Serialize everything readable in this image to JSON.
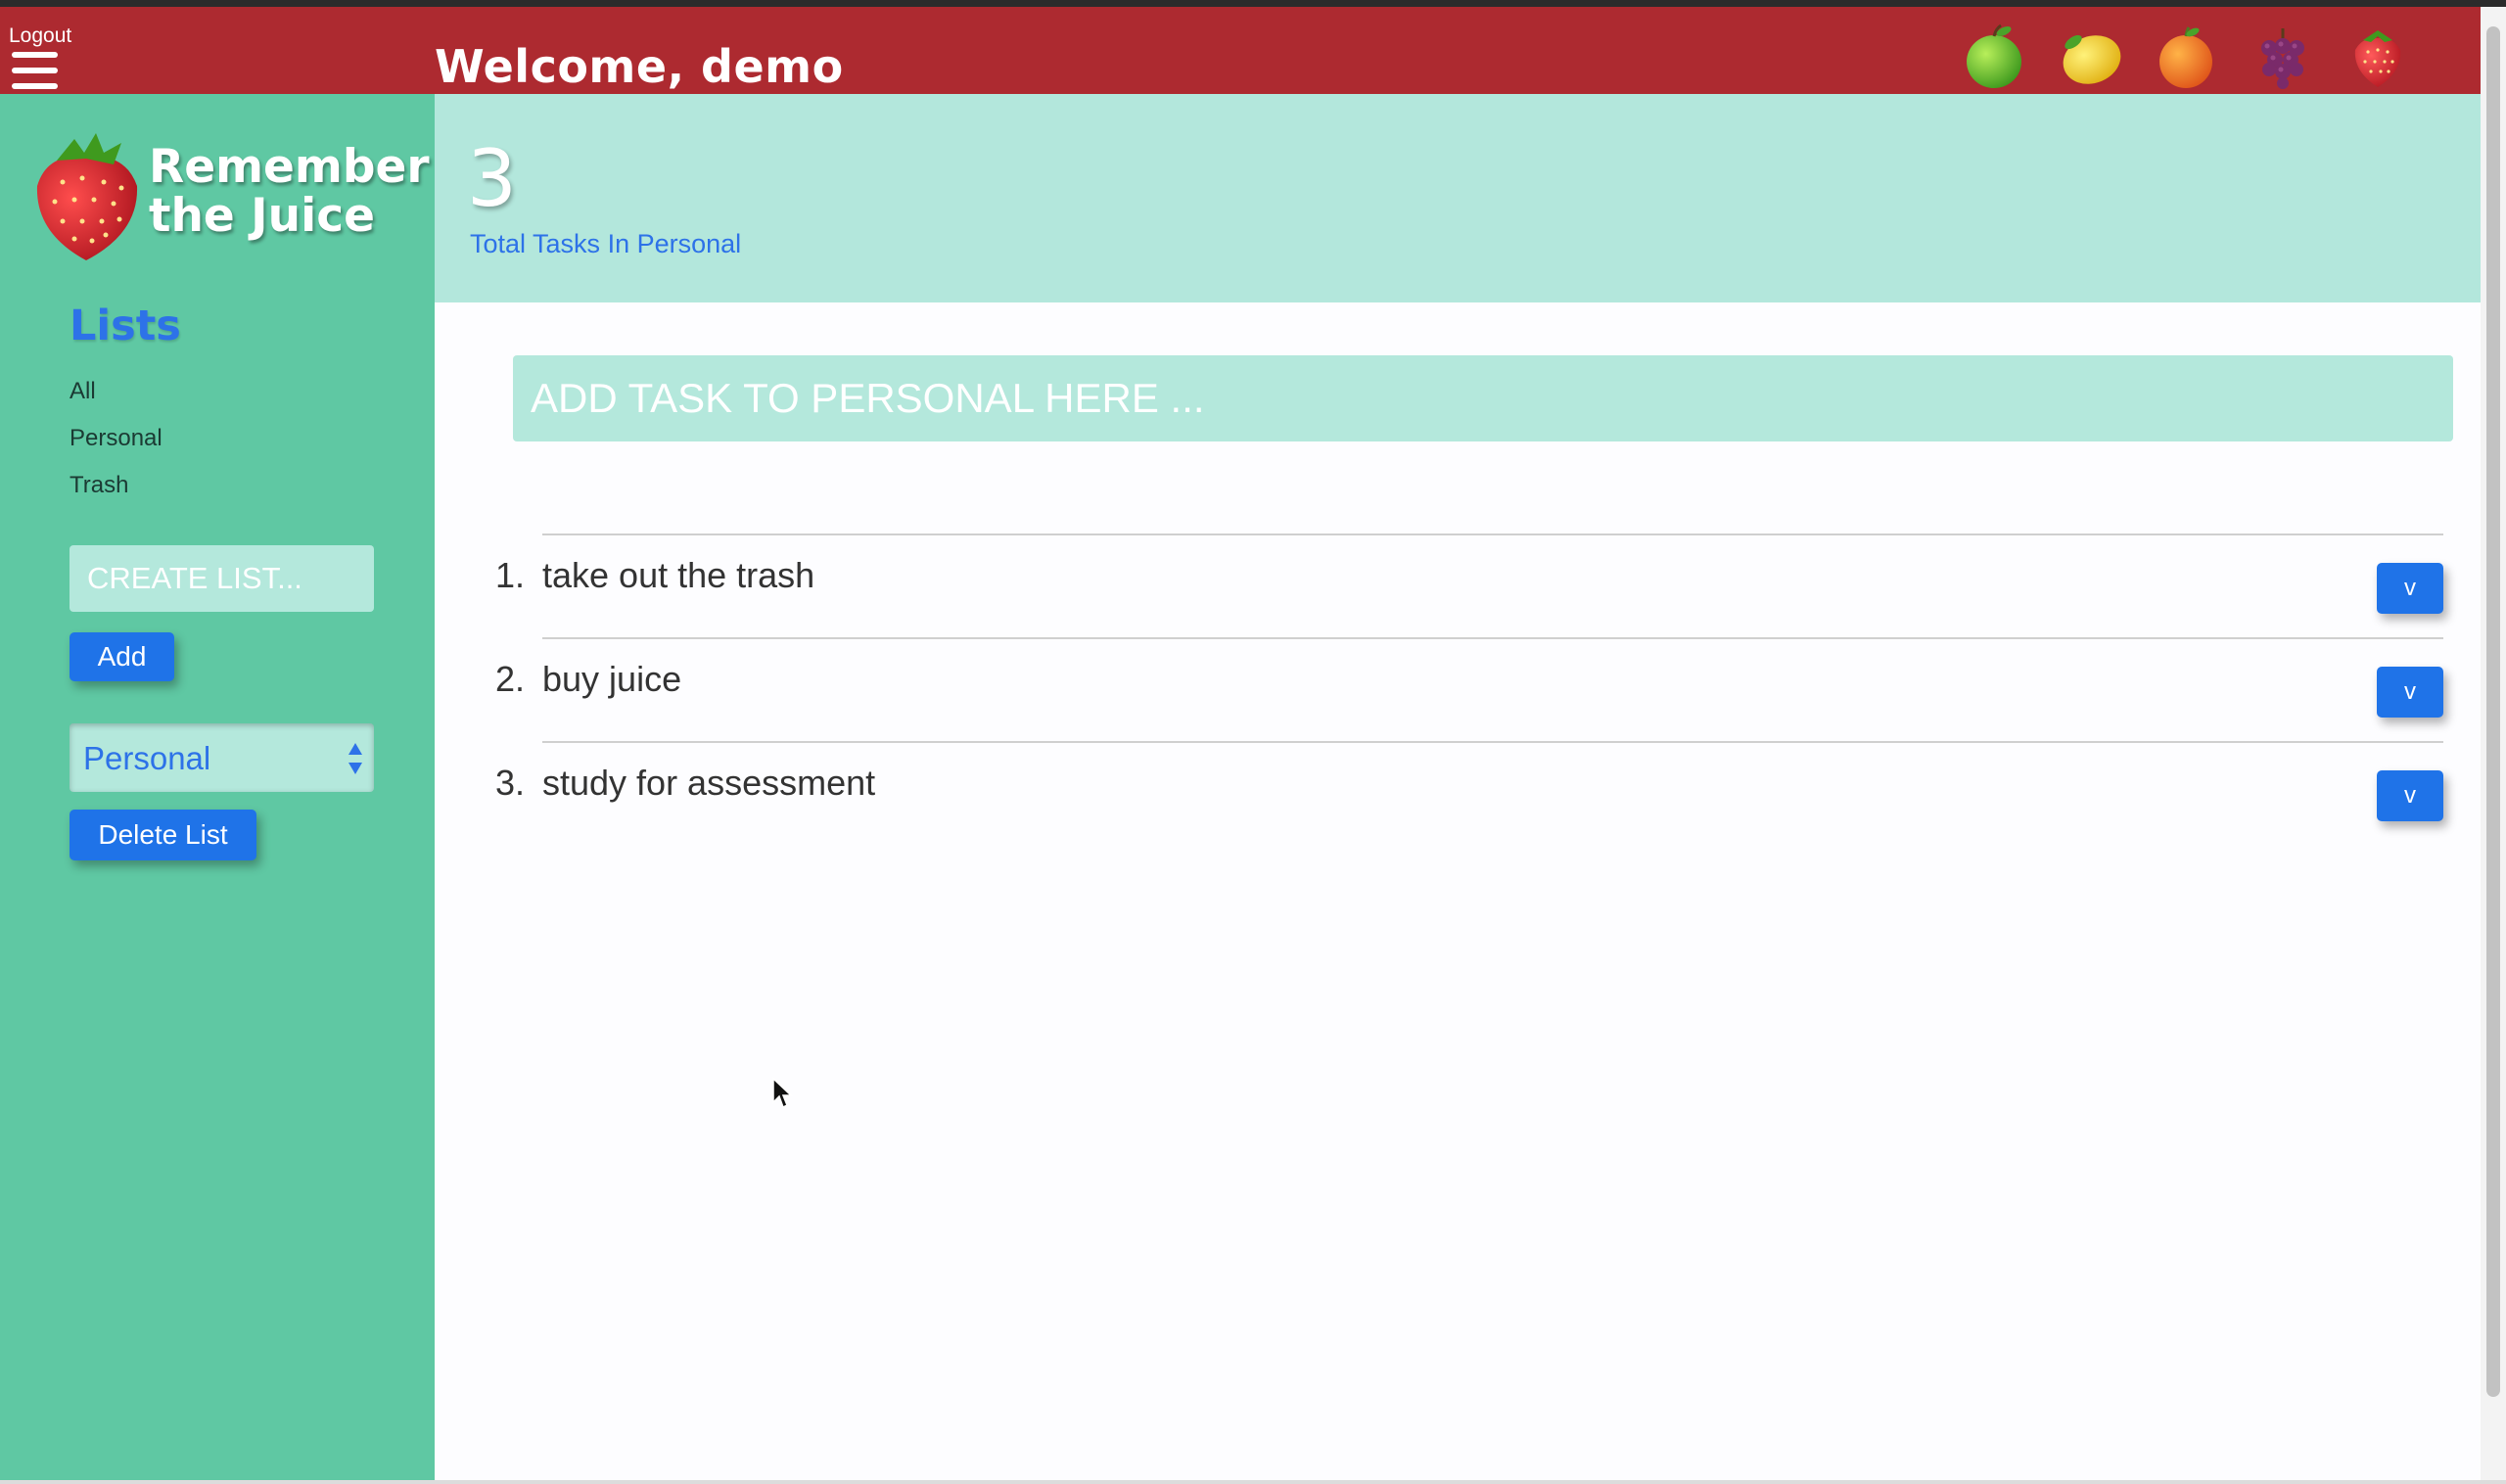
{
  "topbar": {
    "logout_label": "Logout",
    "welcome_text": "Welcome, demo",
    "fruit_icons": [
      "green-apple-icon",
      "lemon-icon",
      "orange-icon",
      "grapes-icon",
      "strawberry-icon"
    ]
  },
  "brand": {
    "line1": "Remember",
    "line2": "the Juice"
  },
  "sidebar": {
    "lists_heading": "Lists",
    "list_links": [
      "All",
      "Personal",
      "Trash"
    ],
    "create_placeholder": "CREATE LIST...",
    "add_label": "Add",
    "selected_list": "Personal",
    "delete_label": "Delete List"
  },
  "stats": {
    "count": "3",
    "label": "Total Tasks In Personal"
  },
  "main": {
    "task_placeholder": "ADD TASK TO PERSONAL HERE ...",
    "tasks": [
      {
        "num": "1.",
        "text": "take out the trash",
        "button": "v"
      },
      {
        "num": "2.",
        "text": "buy juice",
        "button": "v"
      },
      {
        "num": "3.",
        "text": "study for assessment",
        "button": "v"
      }
    ]
  },
  "colors": {
    "topbar": "#ad2a30",
    "sidebar": "#5fc8a3",
    "stats_bg": "#b3e7dc",
    "accent_blue": "#1f73e8"
  }
}
